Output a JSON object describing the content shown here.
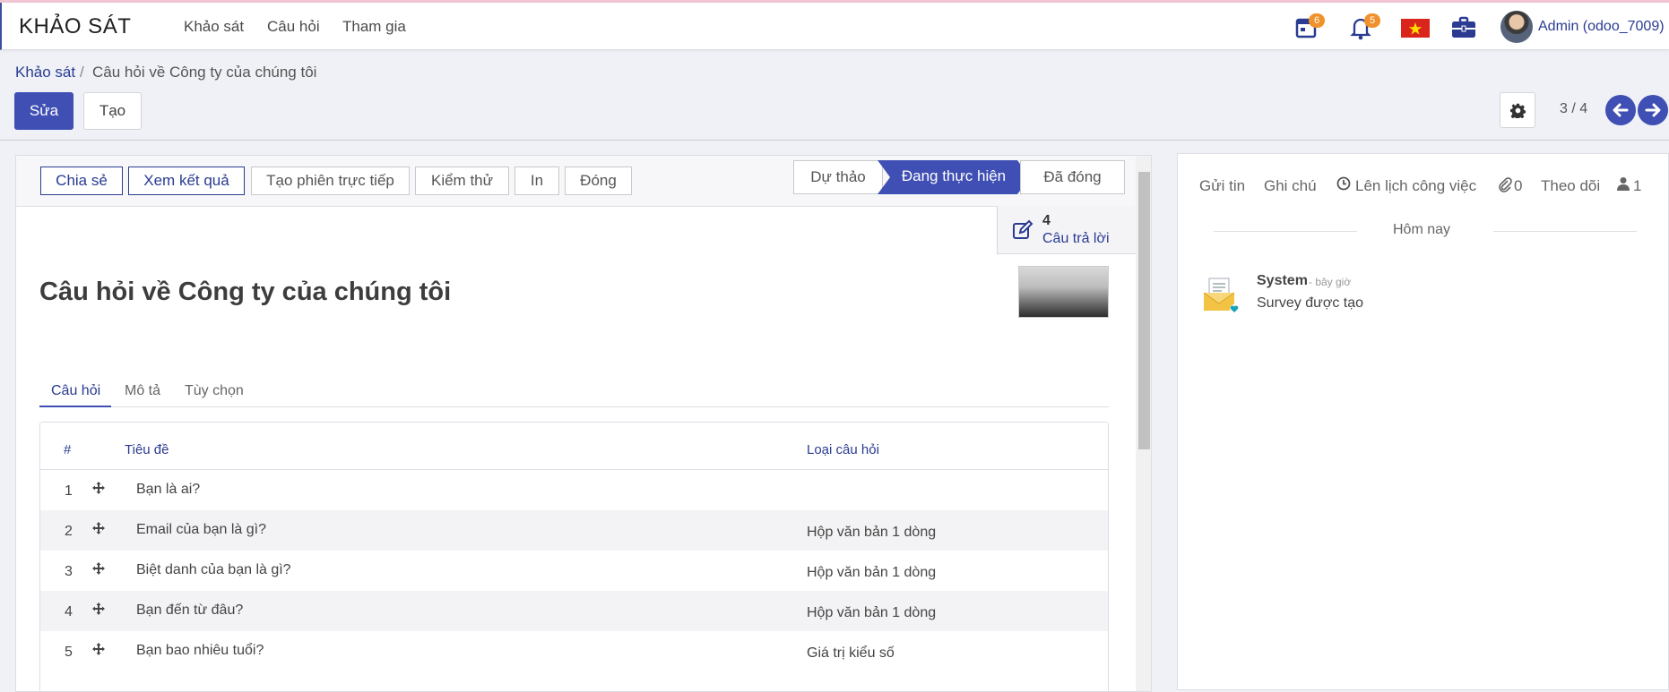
{
  "colors": {
    "primary": "#3f4fb3",
    "link": "#2a3b91",
    "badge": "#f0912b",
    "background": "#eff1f6"
  },
  "navbar": {
    "brand": "KHẢO SÁT",
    "menu": [
      "Khảo sát",
      "Câu hỏi",
      "Tham gia"
    ],
    "activity_badge": "6",
    "notification_badge": "5",
    "user": "Admin (odoo_7009)"
  },
  "breadcrumb": {
    "parent": "Khảo sát",
    "separator": "/",
    "current": "Câu hỏi về Công ty của chúng tôi"
  },
  "actions": {
    "edit": "Sửa",
    "create": "Tạo"
  },
  "pager": {
    "value": "3 / 4"
  },
  "statusbar": {
    "buttons": [
      "Chia sẻ",
      "Xem kết quả",
      "Tạo phiên trực tiếp",
      "Kiểm thử",
      "In",
      "Đóng"
    ],
    "stages": {
      "draft": "Dự thảo",
      "active": "Đang thực hiện",
      "closed": "Đã đóng"
    }
  },
  "smart_button": {
    "count": "4",
    "label": "Câu trả lời"
  },
  "form": {
    "title": "Câu hỏi về Công ty của chúng tôi",
    "tabs": [
      "Câu hỏi",
      "Mô tả",
      "Tùy chọn"
    ]
  },
  "table": {
    "headers": {
      "num": "#",
      "title": "Tiêu đề",
      "type": "Loại câu hỏi"
    },
    "rows": [
      {
        "num": "1",
        "title": "Bạn là ai?",
        "type": ""
      },
      {
        "num": "2",
        "title": "Email của bạn là gì?",
        "type": "Hộp văn bản 1 dòng"
      },
      {
        "num": "3",
        "title": "Biệt danh của bạn là gì?",
        "type": "Hộp văn bản 1 dòng"
      },
      {
        "num": "4",
        "title": "Bạn đến từ đâu?",
        "type": "Hộp văn bản 1 dòng"
      },
      {
        "num": "5",
        "title": "Bạn bao nhiêu tuổi?",
        "type": "Giá trị kiểu số"
      }
    ]
  },
  "chatter": {
    "send_message": "Gửi tin",
    "log_note": "Ghi chú",
    "schedule_activity": "Lên lịch công việc",
    "attachments": "0",
    "follow": "Theo dõi",
    "followers": "1",
    "date_separator": "Hôm nay",
    "message": {
      "author": "System",
      "time": "- bây giờ",
      "body": "Survey được tạo"
    }
  }
}
